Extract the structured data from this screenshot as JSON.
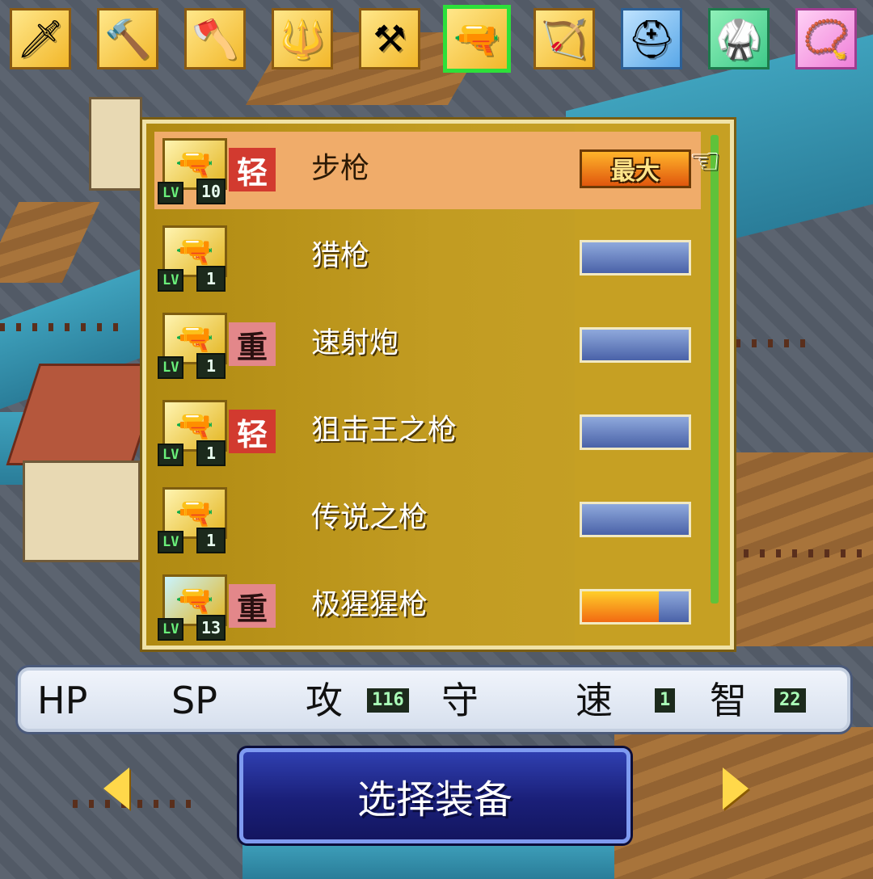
{
  "tabs": [
    {
      "name": "sword-tab",
      "icon": "sword-icon",
      "glyph": "🗡",
      "style": "gold",
      "active": false
    },
    {
      "name": "mace-tab",
      "icon": "mace-icon",
      "glyph": "🔨",
      "style": "gold",
      "active": false
    },
    {
      "name": "axe-tab",
      "icon": "axe-icon",
      "glyph": "🪓",
      "style": "gold",
      "active": false
    },
    {
      "name": "spear-tab",
      "icon": "spear-icon",
      "glyph": "🔱",
      "style": "gold",
      "active": false
    },
    {
      "name": "hammer-tab",
      "icon": "hammer-icon",
      "glyph": "⚒",
      "style": "gold",
      "active": false
    },
    {
      "name": "gun-tab",
      "icon": "gun-icon",
      "glyph": "🔫",
      "style": "gold",
      "active": true
    },
    {
      "name": "bow-tab",
      "icon": "bow-icon",
      "glyph": "🏹",
      "style": "gold",
      "active": false
    },
    {
      "name": "helmet-tab",
      "icon": "helmet-icon",
      "glyph": "⛑",
      "style": "blue",
      "active": false
    },
    {
      "name": "armor-tab",
      "icon": "armor-icon",
      "glyph": "🥋",
      "style": "green",
      "active": false
    },
    {
      "name": "necklace-tab",
      "icon": "necklace-icon",
      "glyph": "📿",
      "style": "pink",
      "active": false
    }
  ],
  "items": [
    {
      "name": "步枪",
      "lv_label": "LV",
      "level": "10",
      "weight": "轻",
      "weight_type": "light",
      "selected": true,
      "max_label": "最大",
      "progress": null
    },
    {
      "name": "猎枪",
      "lv_label": "LV",
      "level": "1",
      "weight": "",
      "weight_type": "none",
      "selected": false,
      "max_label": "",
      "progress": 0
    },
    {
      "name": "速射炮",
      "lv_label": "LV",
      "level": "1",
      "weight": "重",
      "weight_type": "heavy",
      "selected": false,
      "max_label": "",
      "progress": 0
    },
    {
      "name": "狙击王之枪",
      "lv_label": "LV",
      "level": "1",
      "weight": "轻",
      "weight_type": "light",
      "selected": false,
      "max_label": "",
      "progress": 0
    },
    {
      "name": "传说之枪",
      "lv_label": "LV",
      "level": "1",
      "weight": "",
      "weight_type": "none",
      "selected": false,
      "max_label": "",
      "progress": 0
    },
    {
      "name": "极猩猩枪",
      "lv_label": "LV",
      "level": "13",
      "weight": "重",
      "weight_type": "heavy",
      "selected": false,
      "max_label": "",
      "progress": 0.72
    }
  ],
  "stats": {
    "hp_label": "HP",
    "hp_value": "",
    "sp_label": "SP",
    "sp_value": "",
    "atk_label": "攻",
    "atk_value": "116",
    "def_label": "守",
    "def_value": "",
    "spd_label": "速",
    "spd_value": "1",
    "int_label": "智",
    "int_value": "22"
  },
  "select_button_label": "选择装备",
  "colors": {
    "panel_bg": "#c29c22",
    "selected_row": "#f0ac6a",
    "light_tag": "#d23a2f",
    "heavy_tag": "#e3878a",
    "button_bg": "#1a1f78"
  }
}
